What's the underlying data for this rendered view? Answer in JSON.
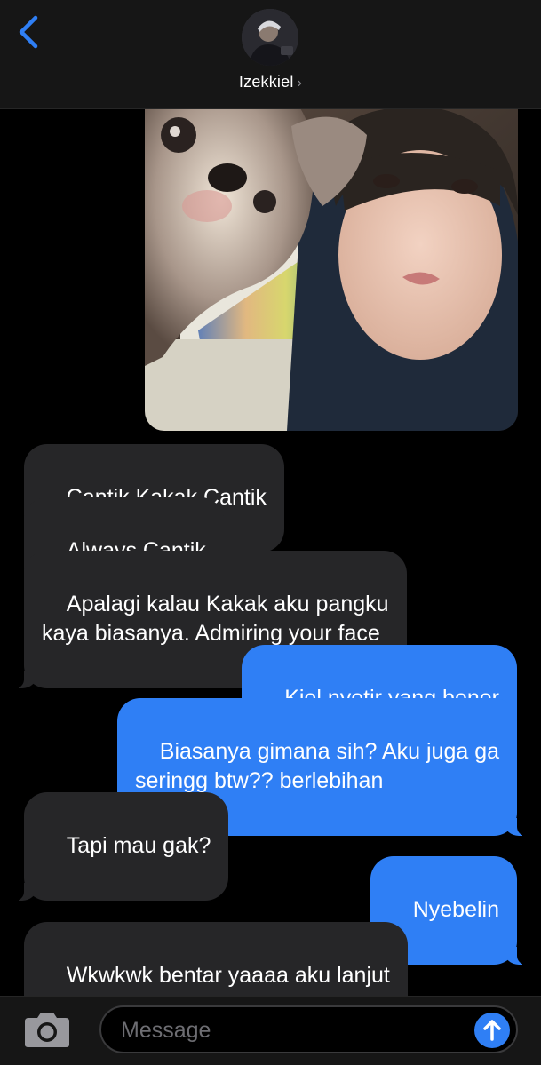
{
  "header": {
    "contact_name": "Izekkiel",
    "chevron": "›",
    "back_icon": "chevron-left-icon",
    "avatar": "contact-avatar"
  },
  "colors": {
    "accent": "#2f7ff5",
    "incoming_bubble": "#262628",
    "background": "#000000",
    "bar": "#161616"
  },
  "messages": [
    {
      "side": "in",
      "text": "Cantik Kakak Cantik"
    },
    {
      "side": "in",
      "text": "Always Cantik"
    },
    {
      "side": "in",
      "text": "Apalagi kalau Kakak aku pangku\nkaya biasanya. Admiring your face"
    },
    {
      "side": "out",
      "text": "Kiel nyetir yang bener"
    },
    {
      "side": "out",
      "text": "Biasanya gimana sih? Aku juga ga\nseringg btw?? berlebihan"
    },
    {
      "side": "in",
      "text": "Tapi mau gak?"
    },
    {
      "side": "out",
      "text": "Nyebelin"
    },
    {
      "side": "in",
      "text": "Wkwkwk bentar yaaaa aku lanjut\nnyetir dulu ;)"
    }
  ],
  "composer": {
    "placeholder": "Message",
    "camera_icon": "camera-icon",
    "send_icon": "arrow-up-icon"
  }
}
